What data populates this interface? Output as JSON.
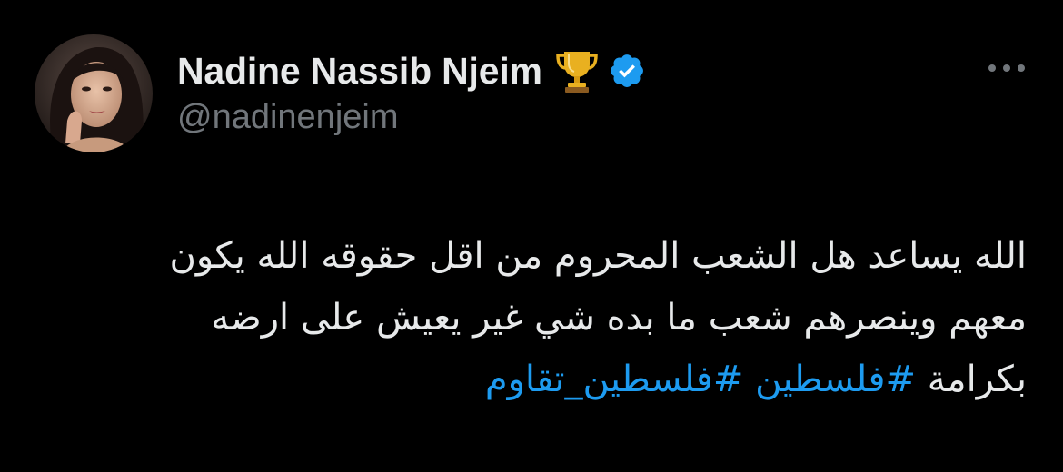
{
  "author": {
    "display_name": "Nadine Nassib Njeim",
    "handle": "@nadinenjeim",
    "badge_emoji": "trophy-icon",
    "verified": true,
    "verified_color": "#1d9bf0"
  },
  "tweet": {
    "line1": "الله يساعد هل الشعب المحروم من اقل حقوقه الله يكون",
    "line2": "معهم وينصرهم شعب ما بده شي غير يعيش على ارضه",
    "line3_prefix": "بكرامة ",
    "hashtags": [
      "#فلسطين",
      "#فلسطين_تقاوم"
    ]
  },
  "actions": {
    "more_icon": "more-horizontal-icon"
  },
  "colors": {
    "background": "#000000",
    "text": "#e7e9ea",
    "secondary": "#71767b",
    "link": "#1d9bf0"
  }
}
